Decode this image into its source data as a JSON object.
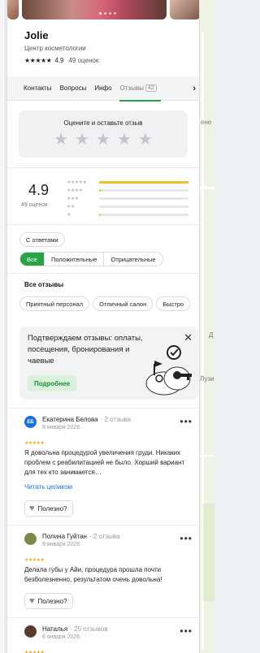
{
  "business": {
    "name": "Jolie",
    "category": "Центр косметологии",
    "rating": "4.9",
    "ratings_count": "49 оценок"
  },
  "tabs": [
    {
      "label": "Контакты"
    },
    {
      "label": "Вопросы"
    },
    {
      "label": "Инфо"
    },
    {
      "label": "Отзывы",
      "badge": "42",
      "active": true
    }
  ],
  "rate_prompt": "Оцените и оставьте отзыв",
  "summary": {
    "rating": "4.9",
    "count": "49 оценок",
    "distribution": [
      {
        "stars": 5,
        "fill": 1.0
      },
      {
        "stars": 4,
        "fill": 0.02
      },
      {
        "stars": 3,
        "fill": 0.0
      },
      {
        "stars": 2,
        "fill": 0.0
      },
      {
        "stars": 1,
        "fill": 0.02
      }
    ]
  },
  "filters": {
    "with_answers": "С ответами",
    "segments": [
      "Все",
      "Положительные",
      "Отрицательные"
    ],
    "active_segment": "Все"
  },
  "all_reviews_title": "Все отзывы",
  "tags": [
    "Приятный персонал",
    "Отличный салон",
    "Быстро"
  ],
  "promo": {
    "text": "Подтверждаем отзывы: оплаты, посещения, бронирования и чаевые",
    "button": "Подробнее",
    "close": "✕"
  },
  "reviews": [
    {
      "initials": "ЕБ",
      "avatar_color": "#1f6fd8",
      "name": "Екатерина Белова",
      "meta": "· 2 отзыва",
      "date": "8 января 2026",
      "stars": "★★★★★",
      "text": "Я довольна процедурой увеличения груди. Никаких проблем с реабилитацией не было. Хорший вариант для тех кто занимается…",
      "read_more": "Читать целиком",
      "useful": "Полезно?"
    },
    {
      "initials": "",
      "avatar_color": "#7a8a4a",
      "name": "Полина Гуйтан",
      "meta": "· 2 отзыва",
      "date": "8 января 2026",
      "stars": "★★★★★",
      "text": "Делала губы у Айи, процедура прошла почти безболезненно, результатом очень довольна!",
      "useful": "Полезно?"
    },
    {
      "initials": "",
      "avatar_color": "#5a3a30",
      "name": "Наталья",
      "meta": "· 25 отзывов",
      "date": "6 января 2026",
      "stars": "★★★★★"
    }
  ],
  "map_labels": [
    "ене",
    "Д",
    "Лузи"
  ],
  "colors": {
    "accent_green": "#29a347",
    "star_yellow": "#f2bd26",
    "link_blue": "#1a73e8"
  }
}
